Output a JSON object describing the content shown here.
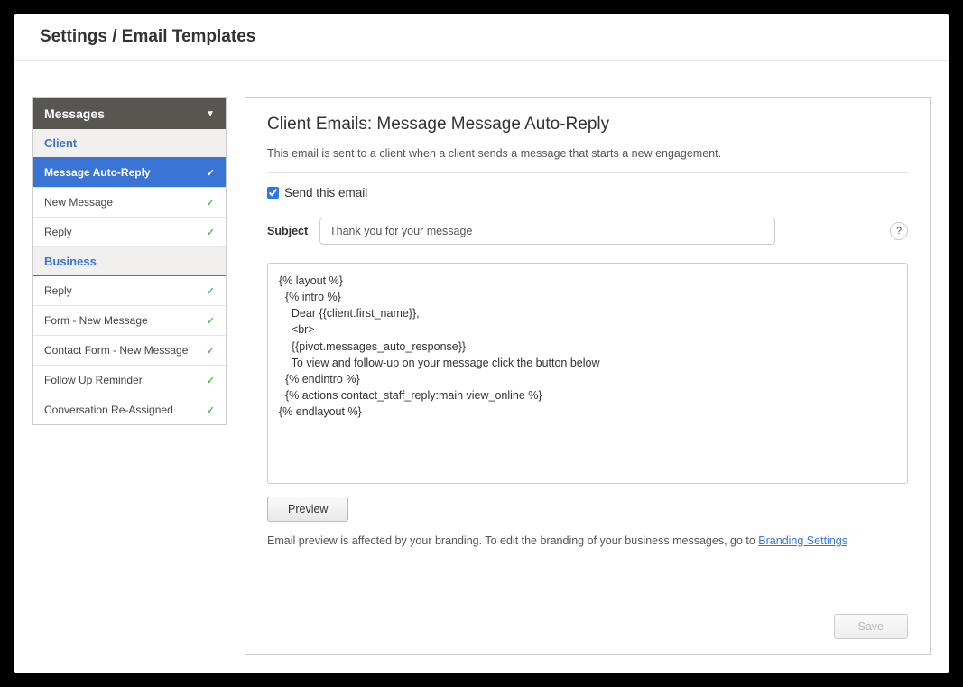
{
  "header": {
    "title": "Settings / Email Templates"
  },
  "sidebar": {
    "header_label": "Messages",
    "sections": [
      {
        "title": "Client",
        "items": [
          {
            "label": "Message Auto-Reply",
            "active": true
          },
          {
            "label": "New Message",
            "active": false
          },
          {
            "label": "Reply",
            "active": false
          }
        ]
      },
      {
        "title": "Business",
        "items": [
          {
            "label": "Reply",
            "active": false
          },
          {
            "label": "Form - New Message",
            "active": false
          },
          {
            "label": "Contact Form - New Message",
            "active": false
          },
          {
            "label": "Follow Up Reminder",
            "active": false
          },
          {
            "label": "Conversation Re-Assigned",
            "active": false
          }
        ]
      }
    ]
  },
  "main": {
    "title": "Client Emails: Message Message Auto-Reply",
    "description": "This email is sent to a client when a client sends a message that starts a new engagement.",
    "send_label": "Send this email",
    "send_checked": true,
    "subject_label": "Subject",
    "subject_value": "Thank you for your message",
    "body_value": "{% layout %}\n  {% intro %}\n    Dear {{client.first_name}},\n    <br>\n    {{pivot.messages_auto_response}}\n    To view and follow-up on your message click the button below\n  {% endintro %}\n  {% actions contact_staff_reply:main view_online %}\n{% endlayout %}",
    "preview_label": "Preview",
    "preview_note_prefix": "Email preview is affected by your branding. To edit the branding of your business messages, go to ",
    "preview_note_link": "Branding Settings",
    "help_label": "?",
    "save_label": "Save"
  }
}
